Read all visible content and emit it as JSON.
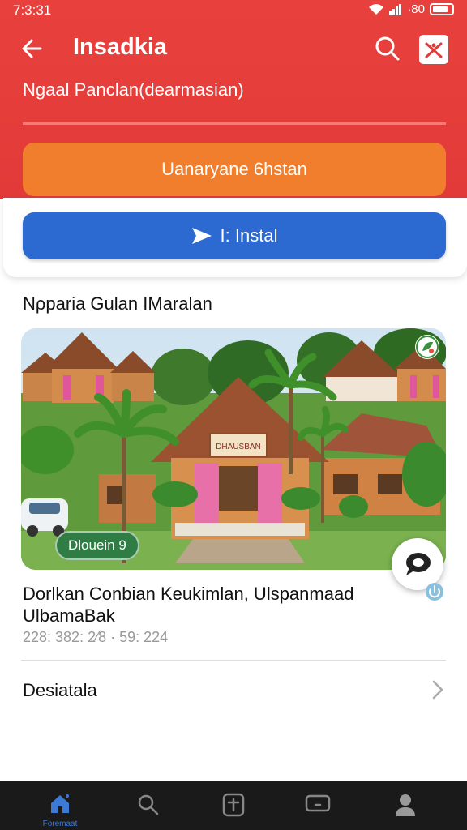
{
  "status_bar": {
    "time": "7:3:31",
    "battery_text": "·80"
  },
  "app_bar": {
    "title": "Insadkia",
    "icons": [
      "back-arrow-icon",
      "search-icon",
      "cart-icon"
    ]
  },
  "subtitle": "Ngaal Panclan(dearmasian)",
  "buttons": {
    "orange_label": "Uanaryane 6hstan",
    "install_label": "I: Instal"
  },
  "section_title": "Nρparia Gulan IMaralan",
  "hero": {
    "badge": "Dlouein 9",
    "sign_text": "DHAUSBAN"
  },
  "listing": {
    "title": "Dorlkan Conbian Keukimlan, Ulspanmaad UlbamaBak",
    "meta": "228: 382: 2⁄8 · 59: 224"
  },
  "details": {
    "label": "Desiatala"
  },
  "bottom_nav": {
    "items": [
      {
        "icon": "home-icon",
        "label": "Foremaat",
        "active": true
      },
      {
        "icon": "search-icon",
        "label": "",
        "active": false
      },
      {
        "icon": "add-icon",
        "label": "",
        "active": false
      },
      {
        "icon": "tablet-icon",
        "label": "",
        "active": false
      },
      {
        "icon": "profile-icon",
        "label": "",
        "active": false
      }
    ]
  },
  "colors": {
    "header_red": "#e23a38",
    "orange": "#f07e2c",
    "blue": "#2c6ad1",
    "nav_bg": "#1a1a1a",
    "accent_blue": "#3b7bd6"
  }
}
